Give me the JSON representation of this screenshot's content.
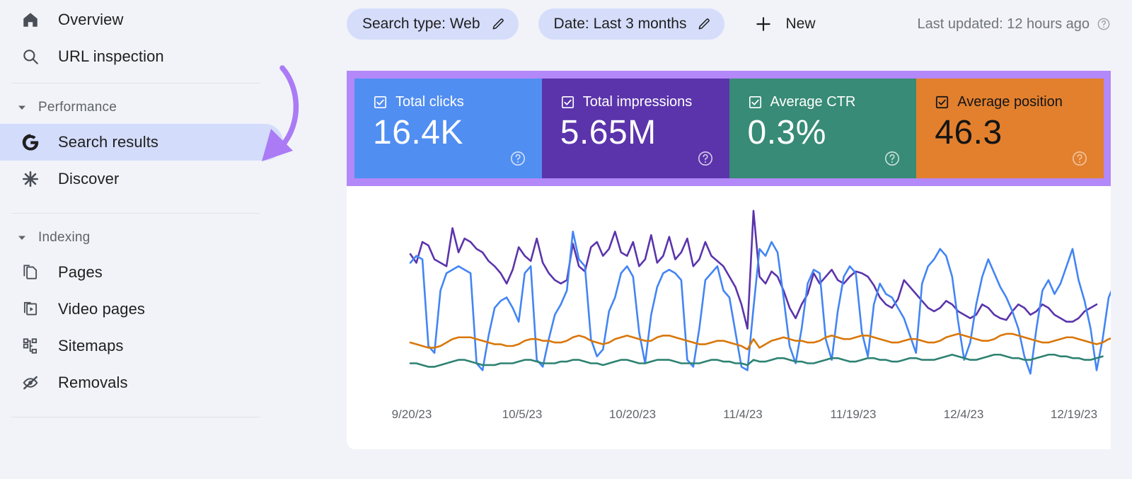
{
  "sidebar": {
    "items_top": [
      {
        "label": "Overview",
        "icon": "home-icon",
        "key": "overview"
      },
      {
        "label": "URL inspection",
        "icon": "search-icon",
        "key": "url-inspection"
      }
    ],
    "performance_group": {
      "label": "Performance",
      "icon": "chevron-down-icon"
    },
    "performance_items": [
      {
        "label": "Search results",
        "icon": "google-g-icon",
        "key": "search-results",
        "active": true
      },
      {
        "label": "Discover",
        "icon": "asterisk-icon",
        "key": "discover",
        "active": false
      }
    ],
    "indexing_group": {
      "label": "Indexing",
      "icon": "chevron-down-icon"
    },
    "indexing_items": [
      {
        "label": "Pages",
        "icon": "pages-icon",
        "key": "pages"
      },
      {
        "label": "Video pages",
        "icon": "video-pages-icon",
        "key": "video-pages"
      },
      {
        "label": "Sitemaps",
        "icon": "sitemaps-icon",
        "key": "sitemaps"
      },
      {
        "label": "Removals",
        "icon": "eye-off-icon",
        "key": "removals"
      }
    ]
  },
  "toolbar": {
    "search_type_chip": "Search type: Web",
    "date_chip": "Date: Last 3 months",
    "new_label": "New",
    "last_updated": "Last updated: 12 hours ago",
    "pencil_icon": "pencil-icon",
    "plus_icon": "plus-icon",
    "help_icon": "help-circle-icon"
  },
  "metric_cards": [
    {
      "title": "Total clicks",
      "value": "16.4K",
      "bg": "#518ef1",
      "text": "light",
      "key": "total-clicks"
    },
    {
      "title": "Total impressions",
      "value": "5.65M",
      "bg": "#5b34ab",
      "text": "light",
      "key": "total-impressions"
    },
    {
      "title": "Average CTR",
      "value": "0.3%",
      "bg": "#388b76",
      "text": "light",
      "key": "average-ctr"
    },
    {
      "title": "Average position",
      "value": "46.3",
      "bg": "#e2802e",
      "text": "dark",
      "key": "average-position"
    }
  ],
  "highlight": {
    "frame_color": "#b388f8",
    "arrow_color": "#ab7bf5"
  },
  "chart_data": {
    "type": "line",
    "title": "",
    "xlabel": "",
    "ylabel": "",
    "grid": false,
    "legend": "top-cards",
    "x_ticks": [
      "9/20/23",
      "10/5/23",
      "10/20/23",
      "11/4/23",
      "11/19/23",
      "12/4/23",
      "12/19/23"
    ],
    "x_range": [
      "9/20/23",
      "12/19/23"
    ],
    "series": [
      {
        "name": "Total impressions",
        "color": "#5b34ab",
        "values": [
          73,
          68,
          80,
          78,
          70,
          68,
          66,
          88,
          74,
          82,
          80,
          76,
          74,
          69,
          66,
          62,
          56,
          64,
          77,
          72,
          69,
          82,
          68,
          62,
          58,
          56,
          58,
          79,
          66,
          63,
          77,
          80,
          72,
          76,
          86,
          74,
          72,
          80,
          66,
          70,
          84,
          68,
          72,
          83,
          70,
          74,
          82,
          66,
          70,
          80,
          72,
          69,
          66,
          60,
          54,
          44,
          30,
          98,
          60,
          56,
          63,
          60,
          52,
          42,
          36,
          44,
          50,
          62,
          56,
          60,
          64,
          58,
          56,
          60,
          63,
          62,
          60,
          55,
          48,
          44,
          42,
          47,
          58,
          54,
          50,
          46,
          42,
          40,
          42,
          46,
          44,
          40,
          38,
          36,
          38,
          44,
          42,
          38,
          36,
          35,
          40,
          44,
          42,
          38,
          40,
          44,
          42,
          38,
          36,
          34,
          34,
          36,
          40,
          42,
          44
        ]
      },
      {
        "name": "Total clicks",
        "color": "#4285f4",
        "values": [
          68,
          72,
          70,
          20,
          16,
          52,
          62,
          64,
          66,
          64,
          62,
          10,
          6,
          26,
          42,
          46,
          48,
          42,
          34,
          62,
          66,
          12,
          8,
          24,
          38,
          44,
          52,
          86,
          70,
          66,
          24,
          14,
          18,
          40,
          48,
          62,
          66,
          60,
          28,
          10,
          38,
          54,
          62,
          64,
          62,
          58,
          12,
          8,
          30,
          58,
          62,
          66,
          52,
          48,
          28,
          8,
          6,
          42,
          76,
          72,
          80,
          74,
          48,
          20,
          10,
          30,
          56,
          64,
          62,
          24,
          12,
          40,
          60,
          66,
          62,
          28,
          14,
          44,
          56,
          50,
          48,
          42,
          36,
          26,
          16,
          56,
          66,
          70,
          76,
          72,
          60,
          34,
          12,
          22,
          44,
          60,
          70,
          62,
          54,
          48,
          40,
          30,
          14,
          4,
          30,
          52,
          58,
          50,
          56,
          66,
          76,
          58,
          46,
          30,
          6,
          24,
          48,
          56
        ]
      },
      {
        "name": "Average CTR",
        "color": "#d9770a",
        "values": [
          22,
          21,
          20,
          19,
          19,
          20,
          22,
          24,
          25,
          25,
          25,
          24,
          23,
          22,
          21,
          21,
          20,
          20,
          21,
          23,
          24,
          24,
          23,
          23,
          22,
          22,
          23,
          25,
          26,
          25,
          23,
          22,
          21,
          22,
          24,
          25,
          26,
          25,
          24,
          23,
          23,
          25,
          26,
          26,
          25,
          24,
          23,
          22,
          21,
          21,
          22,
          23,
          23,
          22,
          21,
          20,
          18,
          24,
          19,
          21,
          23,
          24,
          25,
          24,
          23,
          23,
          22,
          22,
          23,
          25,
          26,
          25,
          24,
          24,
          25,
          26,
          26,
          25,
          24,
          23,
          22,
          22,
          23,
          24,
          24,
          23,
          22,
          22,
          23,
          25,
          26,
          27,
          26,
          25,
          24,
          23,
          23,
          24,
          26,
          27,
          27,
          26,
          25,
          24,
          23,
          22,
          22,
          23,
          24,
          25,
          25,
          24,
          23,
          22,
          21,
          22,
          24,
          25
        ]
      },
      {
        "name": "Average position",
        "color": "#2e8272",
        "values": [
          10,
          10,
          9,
          8,
          8,
          9,
          10,
          11,
          12,
          12,
          11,
          10,
          9,
          9,
          9,
          10,
          10,
          10,
          11,
          12,
          12,
          11,
          10,
          10,
          10,
          11,
          11,
          12,
          12,
          11,
          10,
          10,
          9,
          10,
          11,
          12,
          12,
          11,
          10,
          10,
          11,
          12,
          12,
          12,
          11,
          10,
          10,
          10,
          10,
          11,
          12,
          12,
          11,
          11,
          10,
          10,
          9,
          12,
          11,
          11,
          12,
          13,
          13,
          12,
          11,
          11,
          10,
          10,
          11,
          12,
          13,
          13,
          12,
          11,
          11,
          12,
          13,
          13,
          12,
          12,
          11,
          11,
          12,
          13,
          13,
          12,
          12,
          12,
          13,
          14,
          15,
          14,
          13,
          12,
          12,
          13,
          14,
          15,
          15,
          14,
          13,
          13,
          12,
          12,
          13,
          14,
          15,
          15,
          14,
          14,
          13,
          13,
          12,
          12,
          13,
          14
        ]
      }
    ]
  }
}
